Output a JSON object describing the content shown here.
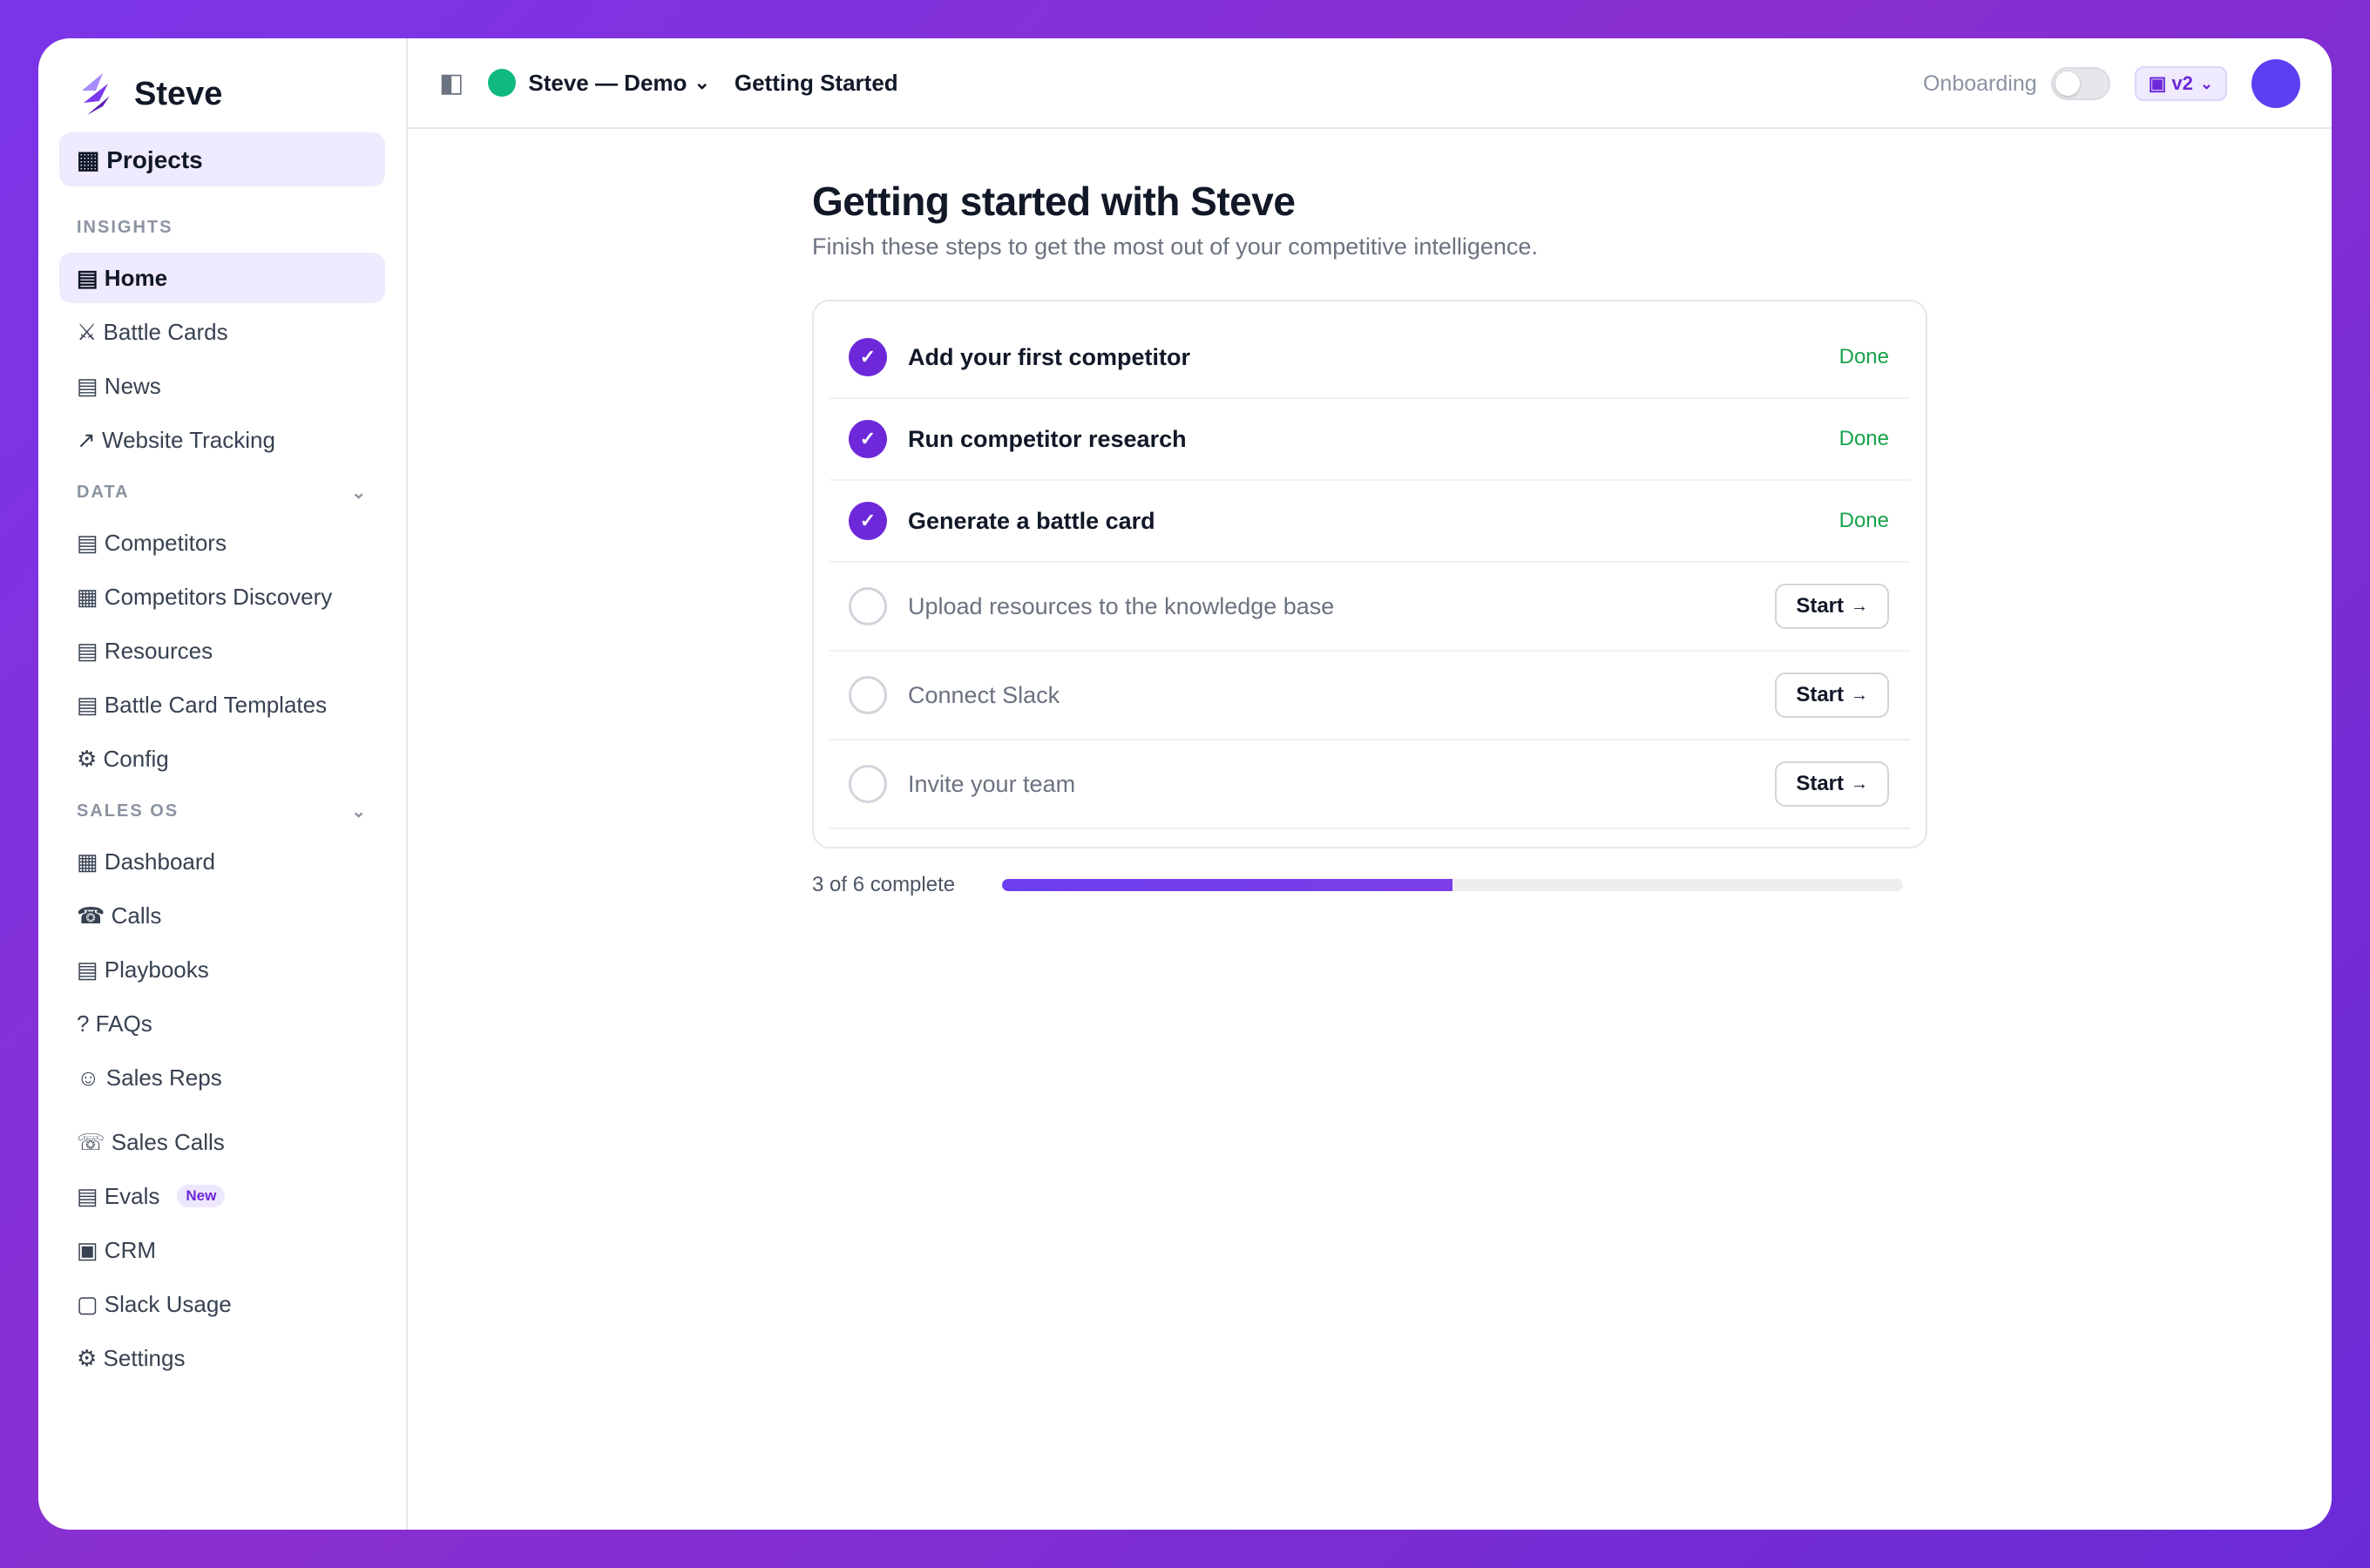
{
  "brand": {
    "name": "Steve"
  },
  "sidebar": {
    "projects_label": "▦ Projects",
    "sections": {
      "insights": {
        "label": "INSIGHTS",
        "items": [
          {
            "label": "▤ Home",
            "active": true
          },
          {
            "label": "⚔ Battle Cards"
          },
          {
            "label": "▤ News"
          },
          {
            "label": "↗ Website Tracking"
          }
        ]
      },
      "data": {
        "label": "DATA",
        "items": [
          {
            "label": "▤ Competitors"
          },
          {
            "label": "▦ Competitors Discovery"
          },
          {
            "label": "▤ Resources"
          },
          {
            "label": "▤ Battle Card Templates"
          },
          {
            "label": "⚙ Config"
          }
        ]
      },
      "sales_os": {
        "label": "SALES OS",
        "items": [
          {
            "label": "▦ Dashboard"
          },
          {
            "label": "☎ Calls"
          },
          {
            "label": "▤ Playbooks"
          },
          {
            "label": "? FAQs"
          },
          {
            "label": "☺ Sales Reps"
          }
        ]
      },
      "other": {
        "items": [
          {
            "label": "☏ Sales Calls"
          },
          {
            "label": "▤ Evals",
            "badge": "New"
          },
          {
            "label": "▣ CRM"
          },
          {
            "label": "▢ Slack Usage"
          },
          {
            "label": "⚙ Settings"
          }
        ]
      }
    }
  },
  "topbar": {
    "panel_toggle_icon": "◧",
    "project_name": "Steve — Demo",
    "project_chevron": "⌄",
    "page": "Getting Started",
    "onboarding_label": "Onboarding",
    "onboarding_enabled": false,
    "version_icon": "▣",
    "version_label": "v2",
    "version_chevron": "⌄"
  },
  "main": {
    "title": "Getting started with Steve",
    "subtitle": "Finish these steps to get the most out of your competitive intelligence.",
    "steps": [
      {
        "label": "Add your first competitor",
        "done": true,
        "status": "Done"
      },
      {
        "label": "Run competitor research",
        "done": true,
        "status": "Done"
      },
      {
        "label": "Generate a battle card",
        "done": true,
        "status": "Done"
      },
      {
        "label": "Upload resources to the knowledge base",
        "done": false,
        "action": "Start"
      },
      {
        "label": "Connect Slack",
        "done": false,
        "action": "Start"
      },
      {
        "label": "Invite your team",
        "done": false,
        "action": "Start"
      }
    ],
    "check_glyph": "✓",
    "action_arrow": "→",
    "progress": {
      "text": "3 of 6 complete",
      "completed": 3,
      "total": 6
    }
  },
  "colors": {
    "accent": "#6d28d9",
    "active_bg": "#efeafd",
    "done_green": "#16a34a",
    "project_dot": "#10b981",
    "avatar": "#5b3ff0",
    "background_gradient": [
      "#7a35e8",
      "#6a2bd6"
    ]
  }
}
